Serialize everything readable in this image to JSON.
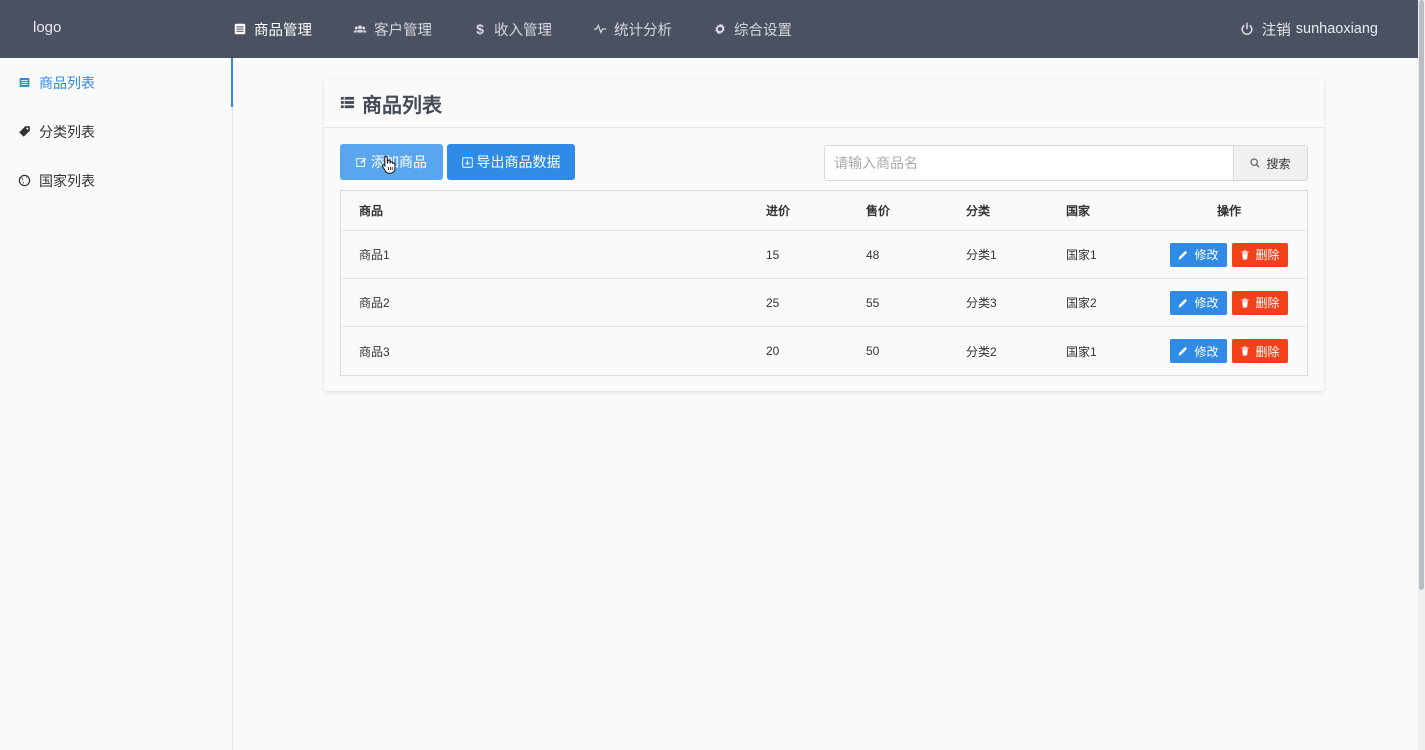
{
  "header": {
    "logo": "logo",
    "nav": [
      {
        "label": "商品管理",
        "icon": "list-icon",
        "active": true
      },
      {
        "label": "客户管理",
        "icon": "users-icon",
        "active": false
      },
      {
        "label": "收入管理",
        "icon": "dollar-icon",
        "active": false
      },
      {
        "label": "统计分析",
        "icon": "pulse-icon",
        "active": false
      },
      {
        "label": "综合设置",
        "icon": "gear-icon",
        "active": false
      }
    ],
    "logout_label": "注销",
    "username": "sunhaoxiang"
  },
  "sidebar": {
    "items": [
      {
        "label": "商品列表",
        "icon": "list-icon",
        "active": true
      },
      {
        "label": "分类列表",
        "icon": "tag-icon",
        "active": false
      },
      {
        "label": "国家列表",
        "icon": "globe-icon",
        "active": false
      }
    ]
  },
  "main": {
    "title": "商品列表",
    "add_button": "添加商品",
    "export_button": "导出商品数据",
    "search": {
      "placeholder": "请输入商品名",
      "value": "",
      "button": "搜索"
    },
    "table": {
      "headers": [
        "商品",
        "进价",
        "售价",
        "分类",
        "国家",
        "操作"
      ],
      "rows": [
        {
          "name": "商品1",
          "cost": "15",
          "price": "48",
          "category": "分类1",
          "country": "国家1"
        },
        {
          "name": "商品2",
          "cost": "25",
          "price": "55",
          "category": "分类3",
          "country": "国家2"
        },
        {
          "name": "商品3",
          "cost": "20",
          "price": "50",
          "category": "分类2",
          "country": "国家1"
        }
      ],
      "edit_label": "修改",
      "delete_label": "删除"
    }
  },
  "colors": {
    "topbar": "#4a5160",
    "primary": "#2f8be6",
    "danger": "#f2401b",
    "primary_light": "#5aa6ee"
  }
}
